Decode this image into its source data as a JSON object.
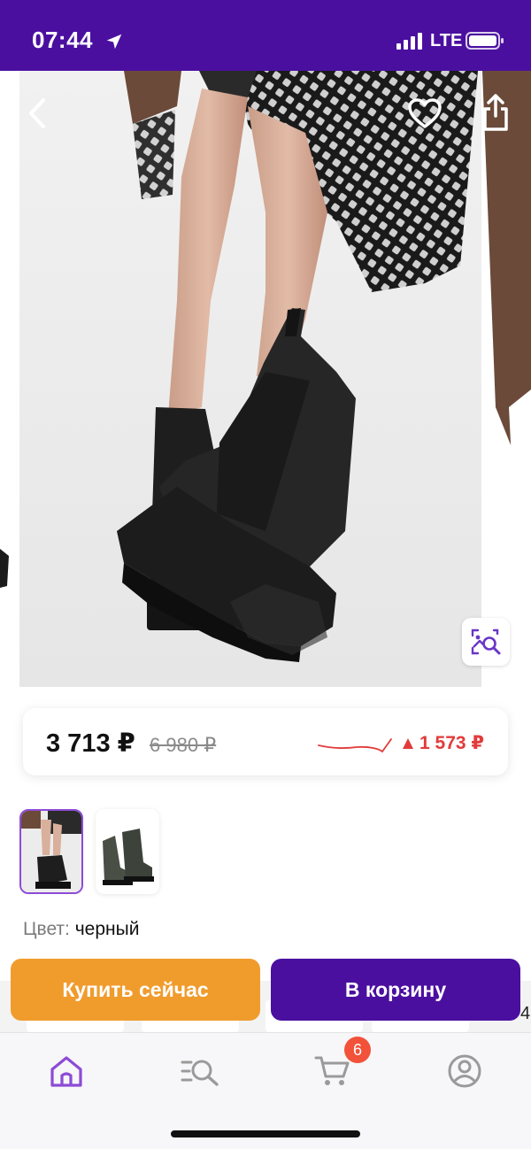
{
  "status_bar": {
    "time": "07:44",
    "network": "LTE",
    "icons": [
      "location-arrow-icon",
      "signal-icon",
      "battery-icon"
    ]
  },
  "hero": {
    "icons": [
      "back-chevron-icon",
      "heart-icon",
      "share-icon",
      "visual-search-icon"
    ]
  },
  "price": {
    "current": "3 713 ₽",
    "old": "6 980 ₽",
    "change": "1 573 ₽",
    "change_color": "#e23b3b"
  },
  "product": {
    "color_label": "Цвет:",
    "color_value": "черный"
  },
  "actions": {
    "buy_now": "Купить сейчас",
    "add_to_cart": "В корзину",
    "buy_color": "#f09c2d",
    "cart_color": "#4b0fa0"
  },
  "partial_text": {
    "edge_digit": "4"
  },
  "tab_bar": {
    "tabs": [
      "home-icon",
      "catalog-search-icon",
      "cart-icon",
      "profile-icon"
    ],
    "cart_badge": "6",
    "active_color": "#8c4bd6"
  }
}
